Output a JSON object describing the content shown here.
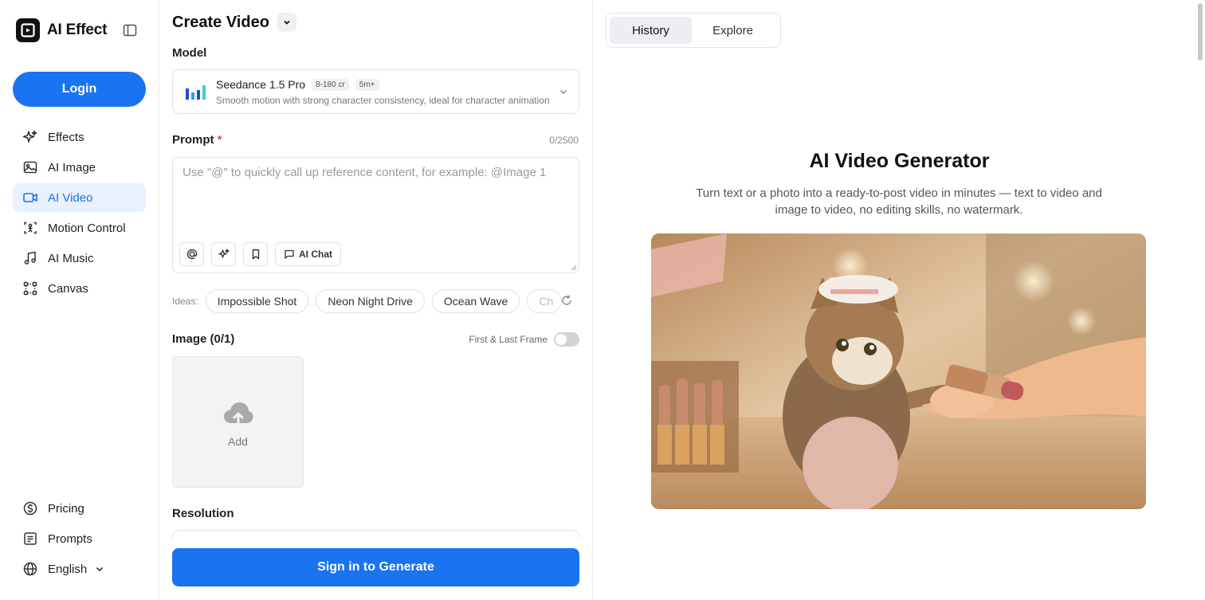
{
  "app": {
    "name": "AI Effect"
  },
  "sidebar": {
    "login_label": "Login",
    "items": [
      {
        "label": "Effects",
        "icon": "sparkle-icon",
        "active": false
      },
      {
        "label": "AI Image",
        "icon": "image-icon",
        "active": false
      },
      {
        "label": "AI Video",
        "icon": "video-icon",
        "active": true
      },
      {
        "label": "Motion Control",
        "icon": "motion-control-icon",
        "active": false
      },
      {
        "label": "AI Music",
        "icon": "music-note-icon",
        "active": false
      },
      {
        "label": "Canvas",
        "icon": "canvas-icon",
        "active": false
      }
    ],
    "bottom_items": [
      {
        "label": "Pricing",
        "icon": "dollar-icon"
      },
      {
        "label": "Prompts",
        "icon": "document-icon"
      },
      {
        "label": "English",
        "icon": "globe-icon"
      }
    ]
  },
  "panel": {
    "title": "Create Video",
    "model_label": "Model",
    "model": {
      "name": "Seedance 1.5 Pro",
      "credits_tag": "8-180 cr",
      "time_tag": "5m+",
      "description": "Smooth motion with strong character consistency, ideal for character animation"
    },
    "prompt_label": "Prompt",
    "prompt_required_mark": "*",
    "prompt_counter": "0/2500",
    "prompt_value": "",
    "prompt_placeholder": "Use \"@\" to quickly call up reference content, for example: @Image 1",
    "ai_chat_label": "AI Chat",
    "ideas_label": "Ideas:",
    "ideas": [
      "Impossible Shot",
      "Neon Night Drive",
      "Ocean Wave",
      "Ch"
    ],
    "image_label": "Image (0/1)",
    "first_last_frame_label": "First & Last Frame",
    "first_last_frame_enabled": false,
    "upload_label": "Add",
    "resolution_label": "Resolution",
    "generate_label": "Sign in to Generate"
  },
  "right": {
    "tabs": [
      {
        "label": "History",
        "active": true
      },
      {
        "label": "Explore",
        "active": false
      }
    ],
    "hero_title": "AI Video Generator",
    "hero_subtitle": "Turn text or a photo into a ready-to-post video in minutes — text to video and image to video, no editing skills, no watermark."
  },
  "colors": {
    "accent": "#1a73f0",
    "active_nav_bg": "#e9f1fe",
    "required": "#e5484d"
  }
}
